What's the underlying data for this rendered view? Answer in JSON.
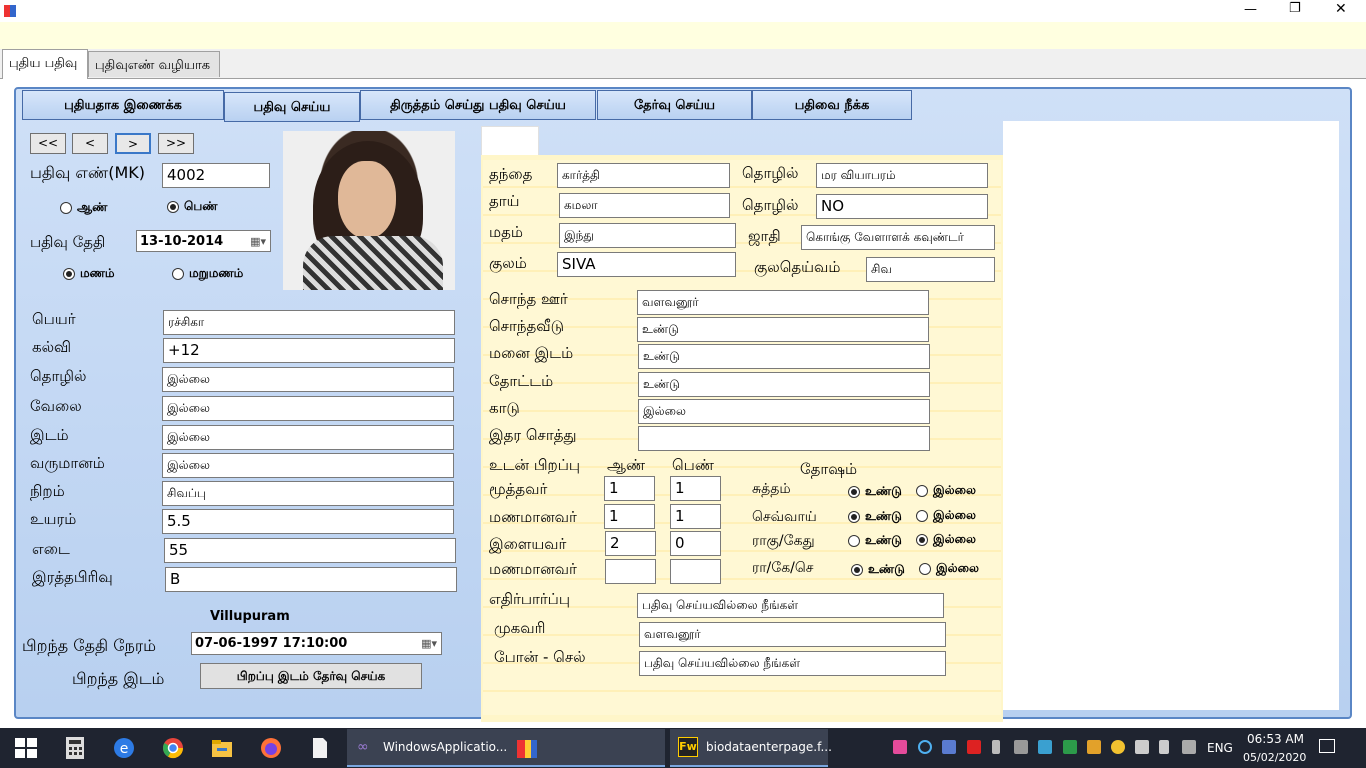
{
  "window": {
    "minimize": "—",
    "maximize": "❐",
    "close": "✕"
  },
  "tabs": [
    "புதிய பதிவு",
    "புதிவுஎண் வழியாக"
  ],
  "toolbar": [
    "புதியதாக இணைக்க",
    "பதிவு செய்ய",
    "திருத்தம் செய்து பதிவு செய்ய",
    "தேர்வு செய்ய",
    "பதிவை நீக்க"
  ],
  "nav": [
    "<<",
    "<",
    ">",
    ">>"
  ],
  "left": {
    "reg_no_label": "பதிவு எண்(MK)",
    "reg_no": "4002",
    "male": "ஆண்",
    "female": "பெண்",
    "reg_date_label": "பதிவு தேதி",
    "reg_date": "13-10-2014",
    "marriage": "மணம்",
    "remarriage": "மறுமணம்",
    "fields": [
      {
        "label": "பெயர்",
        "value": "ரச்சிகா"
      },
      {
        "label": "கல்வி",
        "value": "+12"
      },
      {
        "label": "தொழில்",
        "value": "இல்லை"
      },
      {
        "label": "வேலை",
        "value": "இல்லை"
      },
      {
        "label": "இடம்",
        "value": "இல்லை"
      },
      {
        "label": "வருமானம்",
        "value": "இல்லை"
      },
      {
        "label": "நிறம்",
        "value": "சிவப்பு"
      },
      {
        "label": "உயரம்",
        "value": "5.5"
      },
      {
        "label": "எடை",
        "value": "55"
      },
      {
        "label": "இரத்தபிரிவு",
        "value": "B"
      }
    ],
    "place_name": "Villupuram",
    "birth_dt_label": "பிறந்த தேதி நேரம்",
    "birth_dt": "07-06-1997 17:10:00",
    "birth_place_label": "பிறந்த இடம்",
    "birth_place_btn": "பிறப்பு இடம் தேர்வு செய்க"
  },
  "right": {
    "father_label": "தந்தை",
    "father": "கார்த்தி",
    "f_job_label": "தொழில்",
    "f_job": "மர வியாபரம்",
    "mother_label": "தாய்",
    "mother": "கமலா",
    "m_job_label": "தொழில்",
    "m_job": "NO",
    "religion_label": "மதம்",
    "religion": "இந்து",
    "caste_label": "ஜாதி",
    "caste": "கொங்கு வேளாளக் கவுண்டர்",
    "clan_label": "குலம்",
    "clan": "SIVA",
    "deity_label": "குலதெய்வம்",
    "deity": "சிவ",
    "props": [
      {
        "label": "சொந்த ஊர்",
        "value": "வளவனூர்"
      },
      {
        "label": "சொந்தவீடு",
        "value": "உண்டு"
      },
      {
        "label": "மனை இடம்",
        "value": "உண்டு"
      },
      {
        "label": "தோட்டம்",
        "value": "உண்டு"
      },
      {
        "label": "காடு",
        "value": "இல்லை"
      },
      {
        "label": "இதர சொத்து",
        "value": ""
      }
    ],
    "siblings_label": "உடன் பிறப்பு",
    "male_h": "ஆண்",
    "female_h": "பெண்",
    "dosham_h": "தோஷம்",
    "sib_rows": [
      {
        "label": "மூத்தவர்",
        "m": "1",
        "f": "1"
      },
      {
        "label": "மணமானவர்",
        "m": "1",
        "f": "1"
      },
      {
        "label": "இளையவர்",
        "m": "2",
        "f": "0"
      },
      {
        "label": "மணமானவர்",
        "m": "",
        "f": ""
      }
    ],
    "dosham": [
      {
        "label": "சுத்தம்",
        "yes": true
      },
      {
        "label": "செவ்வாய்",
        "yes": true
      },
      {
        "label": "ராகு/கேது",
        "yes": false
      },
      {
        "label": "ரா/கே/செ",
        "yes": true
      }
    ],
    "yes": "உண்டு",
    "no": "இல்லை",
    "expect_label": "எதிர்பார்ப்பு",
    "expect": "பதிவு செய்யவில்லை நீங்கள்",
    "address_label": "முகவரி",
    "address": "வளவனூர்",
    "phone_label": "போன் - செல்",
    "phone": "பதிவு செய்யவில்லை நீங்கள்"
  },
  "taskbar": {
    "app1": "WindowsApplicatio...",
    "app3": "biodataenterpage.f...",
    "lang": "ENG",
    "time": "06:53 AM",
    "date": "05/02/2020"
  }
}
